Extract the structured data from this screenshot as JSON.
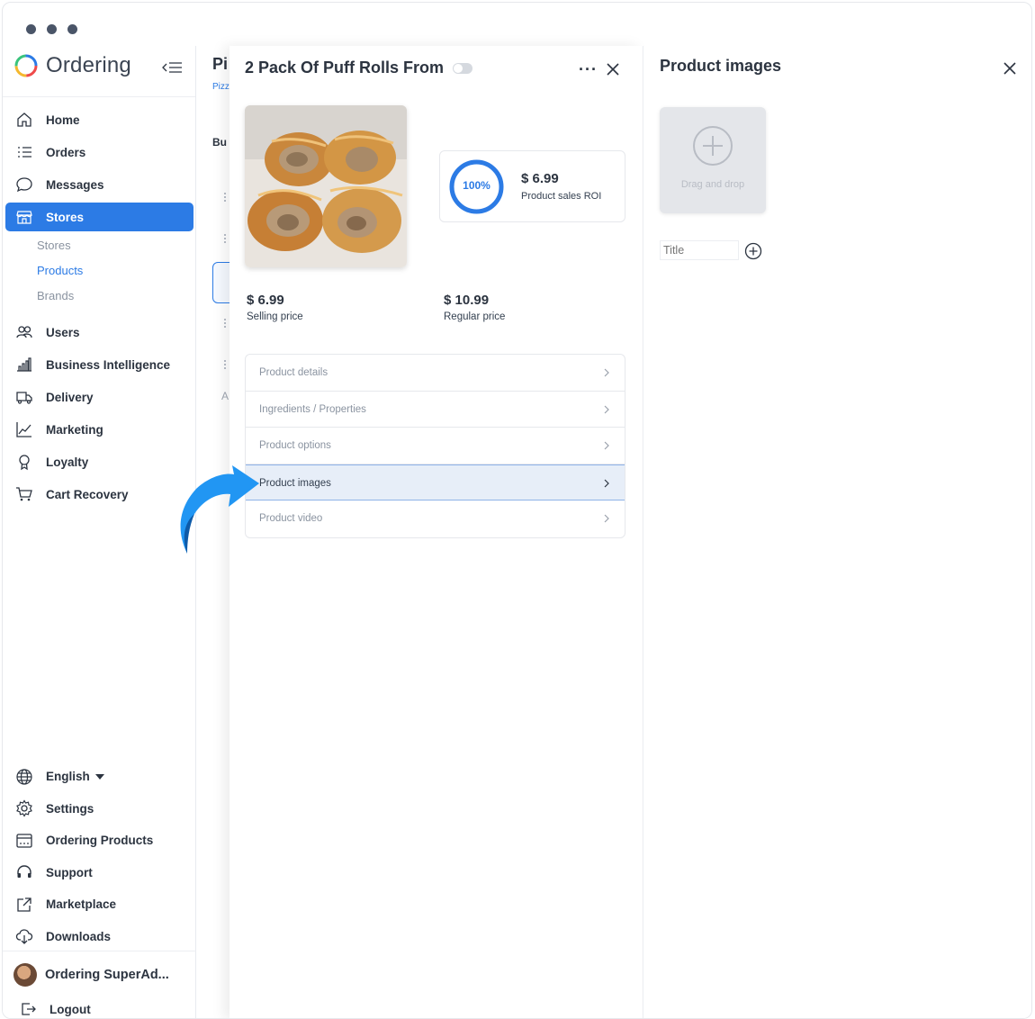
{
  "app": {
    "name": "Ordering"
  },
  "sidebar": {
    "items": [
      {
        "label": "Home",
        "icon": "home-icon"
      },
      {
        "label": "Orders",
        "icon": "list-icon"
      },
      {
        "label": "Messages",
        "icon": "chat-icon"
      },
      {
        "label": "Stores",
        "icon": "store-icon"
      }
    ],
    "subitems": [
      "Stores",
      "Products",
      "Brands"
    ],
    "items2": [
      {
        "label": "Users",
        "icon": "users-icon"
      },
      {
        "label": "Business Intelligence",
        "icon": "bar-chart-icon"
      },
      {
        "label": "Delivery",
        "icon": "truck-icon"
      },
      {
        "label": "Marketing",
        "icon": "line-chart-icon"
      },
      {
        "label": "Loyalty",
        "icon": "medal-icon"
      },
      {
        "label": "Cart Recovery",
        "icon": "cart-icon"
      }
    ],
    "bottom": [
      {
        "label": "English",
        "icon": "globe-icon"
      },
      {
        "label": "Settings",
        "icon": "gear-icon"
      },
      {
        "label": "Ordering Products",
        "icon": "calendar-icon"
      },
      {
        "label": "Support",
        "icon": "headset-icon"
      },
      {
        "label": "Marketplace",
        "icon": "external-link-icon"
      },
      {
        "label": "Downloads",
        "icon": "cloud-download-icon"
      }
    ],
    "user": "Ordering SuperAd...",
    "logout": "Logout"
  },
  "background_page": {
    "title": "Pi",
    "subtitle": "Pizz",
    "section": "Bu",
    "footer": "A"
  },
  "product": {
    "title": "2 Pack Of Puff Rolls From",
    "roi_percent": "100%",
    "roi_price": "$ 6.99",
    "roi_label": "Product sales ROI",
    "selling_price": "$ 6.99",
    "selling_label": "Selling price",
    "regular_price": "$ 10.99",
    "regular_label": "Regular price",
    "menu": [
      "Product details",
      "Ingredients / Properties",
      "Product options",
      "Product images",
      "Product video"
    ]
  },
  "images_panel": {
    "title": "Product images",
    "drop_text": "Drag and drop",
    "title_placeholder": "Title"
  },
  "colors": {
    "accent": "#2c7be5",
    "arrow": "#2196f3"
  }
}
